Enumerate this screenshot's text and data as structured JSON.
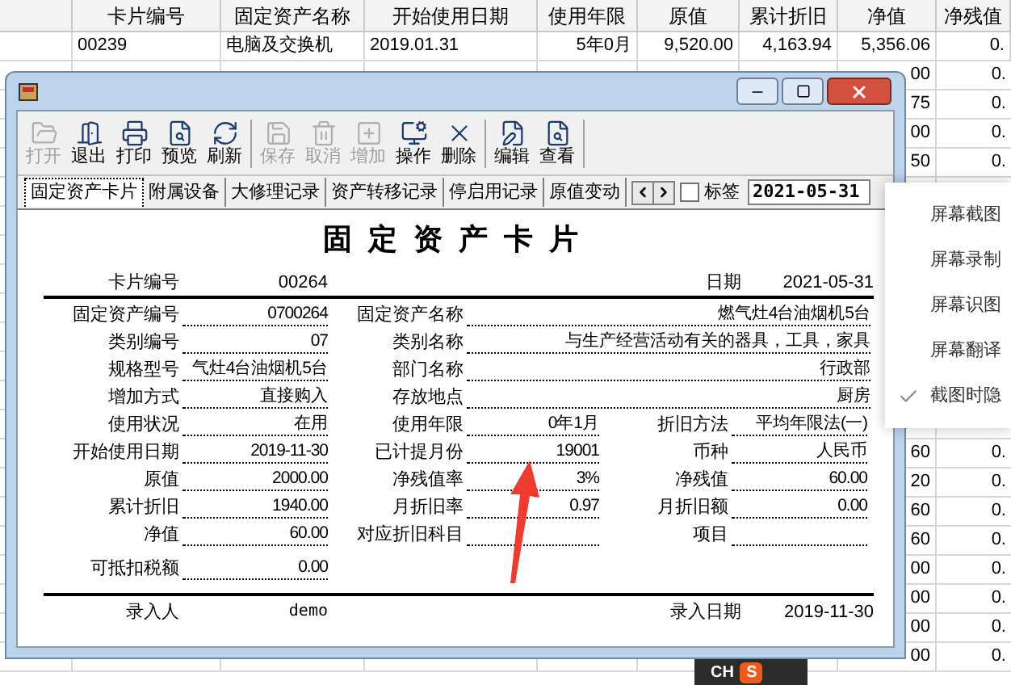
{
  "background_table": {
    "columns": [
      "卡片编号",
      "固定资产名称",
      "开始使用日期",
      "使用年限",
      "原值",
      "累计折旧",
      "净值",
      "净残值"
    ],
    "first_row": [
      "00239",
      "电脑及交换机",
      "2019.01.31",
      "5年0月",
      "9,520.00",
      "4,163.94",
      "5,356.06",
      "0."
    ],
    "edge_rows": [
      {
        "net_value": "00",
        "rate": "0."
      },
      {
        "net_value": "75",
        "rate": "0."
      },
      {
        "net_value": "00",
        "rate": "0."
      },
      {
        "net_value": "50",
        "rate": "0."
      },
      {},
      {},
      {},
      {},
      {},
      {},
      {},
      {},
      {},
      {
        "net_value": "60",
        "rate": "0."
      },
      {
        "net_value": "20",
        "rate": "0."
      },
      {
        "net_value": "60",
        "rate": "0."
      },
      {
        "net_value": "60",
        "rate": "0."
      },
      {
        "net_value": "00",
        "rate": "0."
      },
      {
        "net_value": "00",
        "rate": "0."
      },
      {
        "net_value": "00",
        "rate": "0."
      },
      {
        "net_value": "00",
        "rate": "0."
      }
    ]
  },
  "toolbar": [
    [
      {
        "label": "打开",
        "disabled": true
      },
      {
        "label": "退出",
        "disabled": false
      },
      {
        "label": "打印",
        "disabled": false
      },
      {
        "label": "预览",
        "disabled": false
      },
      {
        "label": "刷新",
        "disabled": false
      }
    ],
    [
      {
        "label": "保存",
        "disabled": true
      },
      {
        "label": "取消",
        "disabled": true
      },
      {
        "label": "增加",
        "disabled": true
      },
      {
        "label": "操作",
        "disabled": false
      },
      {
        "label": "删除",
        "disabled": false
      }
    ],
    [
      {
        "label": "编辑",
        "disabled": false
      },
      {
        "label": "查看",
        "disabled": false
      }
    ]
  ],
  "tabs": [
    {
      "label": "固定资产卡片",
      "selected": true
    },
    {
      "label": "附属设备",
      "selected": false
    },
    {
      "label": "大修理记录",
      "selected": false
    },
    {
      "label": "资产转移记录",
      "selected": false
    },
    {
      "label": "停启用记录",
      "selected": false
    },
    {
      "label": "原值变动",
      "selected": false
    }
  ],
  "label_checkbox": {
    "label": "标签",
    "checked": false
  },
  "date_field": {
    "value": "2021-05-31"
  },
  "card": {
    "title": "固定资产卡片",
    "number": {
      "label": "卡片编号",
      "value": "00264"
    },
    "date": {
      "label": "日期",
      "value": "2021-05-31"
    },
    "rows": [
      {
        "kind": "wide",
        "left": {
          "label": "固定资产编号",
          "value": "0700264"
        },
        "middle": {
          "label": "固定资产名称",
          "value": "燃气灶4台油烟机5台"
        }
      },
      {
        "kind": "wide",
        "left": {
          "label": "类别编号",
          "value": "07"
        },
        "middle": {
          "label": "类别名称",
          "value": "与生产经营活动有关的器具，工具，家具"
        }
      },
      {
        "kind": "wide",
        "left": {
          "label": "规格型号",
          "value": "气灶4台油烟机5台"
        },
        "middle": {
          "label": "部门名称",
          "value": "行政部"
        }
      },
      {
        "kind": "wide",
        "left": {
          "label": "增加方式",
          "value": "直接购入"
        },
        "middle": {
          "label": "存放地点",
          "value": "厨房"
        }
      },
      {
        "kind": "triple",
        "left": {
          "label": "使用状况",
          "value": "在用"
        },
        "middle": {
          "label": "使用年限",
          "value": "0年1月"
        },
        "right": {
          "label": "折旧方法",
          "value": "平均年限法(一)"
        }
      },
      {
        "kind": "triple",
        "left": {
          "label": "开始使用日期",
          "value": "2019-11-30"
        },
        "middle": {
          "label": "已计提月份",
          "value": "19001"
        },
        "right": {
          "label": "币种",
          "value": "人民币"
        }
      },
      {
        "kind": "triple",
        "left": {
          "label": "原值",
          "value": "2000.00"
        },
        "middle": {
          "label": "净残值率",
          "value": "3%"
        },
        "right": {
          "label": "净残值",
          "value": "60.00"
        }
      },
      {
        "kind": "triple",
        "left": {
          "label": "累计折旧",
          "value": "1940.00"
        },
        "middle": {
          "label": "月折旧率",
          "value": "0.97"
        },
        "right": {
          "label": "月折旧额",
          "value": "0.00"
        }
      },
      {
        "kind": "triple",
        "left": {
          "label": "净值",
          "value": "60.00"
        },
        "middle": {
          "label": "对应折旧科目"
        },
        "right": {
          "label": "项目"
        }
      },
      {
        "kind": "single",
        "left": {
          "label": "可抵扣税额",
          "value": "0.00"
        }
      }
    ],
    "entered_by": {
      "label": "录入人",
      "value": "demo"
    },
    "entry_date": {
      "label": "录入日期",
      "value": "2019-11-30"
    }
  },
  "context_menu": [
    {
      "label": "屏幕截图",
      "checked": false
    },
    {
      "label": "屏幕录制",
      "checked": false
    },
    {
      "label": "屏幕识图",
      "checked": false
    },
    {
      "label": "屏幕翻译",
      "checked": false
    },
    {
      "label": "截图时隐",
      "checked": true
    }
  ],
  "ime_bar": {
    "language": "CH",
    "logo": "S"
  }
}
